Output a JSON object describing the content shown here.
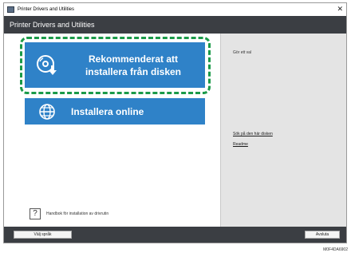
{
  "window": {
    "title": "Printer Drivers and Utilities",
    "close_glyph": "✕"
  },
  "app": {
    "title": "Printer Drivers and Utilities"
  },
  "left": {
    "recommend_label": "Rekommenderat att installera från disken",
    "recommend_icon": "disc-download-icon",
    "online_label": "Installera online",
    "online_icon": "globe-icon",
    "help_glyph": "?",
    "help_text": "Handbok för installation av drivrutin"
  },
  "right": {
    "hint": "Gör ett val",
    "links": [
      "Sök på den här disken",
      "Readme"
    ]
  },
  "bottom": {
    "language_button": "Välj språk",
    "exit_button": "Avsluta"
  },
  "image_code": "M0F4DA6902",
  "colors": {
    "accent": "#2f82c8",
    "highlight": "#1b9a49",
    "bar": "#3b3e43"
  }
}
